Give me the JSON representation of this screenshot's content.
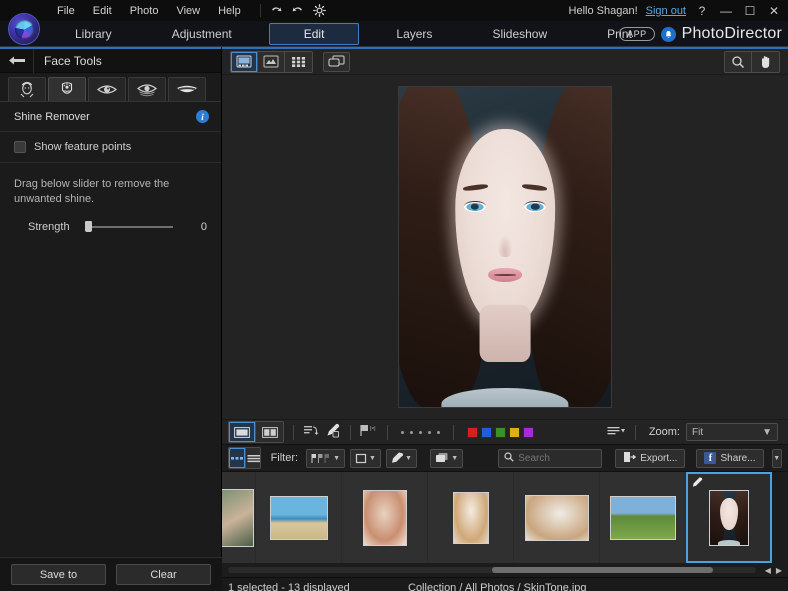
{
  "menubar": {
    "items": [
      {
        "label": "File",
        "name": "menu-file"
      },
      {
        "label": "Edit",
        "name": "menu-edit"
      },
      {
        "label": "Photo",
        "name": "menu-photo"
      },
      {
        "label": "View",
        "name": "menu-view"
      },
      {
        "label": "Help",
        "name": "menu-help"
      }
    ],
    "icons": [
      "undo-icon",
      "redo-icon",
      "settings-gear-icon"
    ],
    "greeting": "Hello Shagan!",
    "signout": "Sign out",
    "help_btn": "?",
    "minimize_btn": "—",
    "maximize_btn": "☐",
    "close_btn": "✕"
  },
  "navbar": {
    "tabs": [
      {
        "label": "Library",
        "active": false
      },
      {
        "label": "Adjustment",
        "active": false
      },
      {
        "label": "Edit",
        "active": true
      },
      {
        "label": "Layers",
        "active": false
      },
      {
        "label": "Slideshow",
        "active": false
      },
      {
        "label": "Print",
        "active": false
      }
    ],
    "app_pill": "APP",
    "brand": "PhotoDirector",
    "accent": "#3f7fc0"
  },
  "left_panel": {
    "back_icon": "back-arrow-icon",
    "title": "Face Tools",
    "tool_tabs": [
      {
        "name": "face-shaper-icon",
        "active": false
      },
      {
        "name": "skin-shine-icon",
        "active": true
      },
      {
        "name": "eye-enhancer-icon",
        "active": false
      },
      {
        "name": "eye-bag-removal-icon",
        "active": false
      },
      {
        "name": "teeth-whitener-icon",
        "active": false
      }
    ],
    "section_title": "Shine Remover",
    "info_icon": "i",
    "checkbox_label": "Show feature points",
    "checkbox_checked": false,
    "hint": "Drag below slider to remove the unwanted shine.",
    "slider": {
      "label": "Strength",
      "value": "0",
      "percent": 0
    },
    "buttons": [
      {
        "label": "Save to",
        "name": "save-to-button"
      },
      {
        "label": "Clear",
        "name": "clear-button"
      }
    ]
  },
  "view_toolbar": {
    "modes": [
      {
        "name": "single-view-icon",
        "active": true
      },
      {
        "name": "compare-view-icon",
        "active": false
      },
      {
        "name": "grid-view-icon",
        "active": false
      }
    ],
    "overlay_icon": "panel-toggle-icon",
    "right_tools": [
      {
        "name": "zoom-tool-icon",
        "active": false
      },
      {
        "name": "hand-tool-icon",
        "active": false
      }
    ]
  },
  "edit_toolbar": {
    "view_buttons": [
      {
        "name": "before-view-icon",
        "active": true
      },
      {
        "name": "before-after-view-icon",
        "active": false
      }
    ],
    "tools": [
      {
        "name": "undo-history-icon"
      },
      {
        "name": "eyedropper-icon"
      },
      {
        "name": "flag-rating-icon"
      }
    ],
    "rating_dots": 5,
    "color_swatches": [
      "#d81f1f",
      "#1f5fd8",
      "#3f8f28",
      "#e0b010",
      "#a02fd8"
    ],
    "list_icon": "list-options-icon",
    "zoom_label": "Zoom:",
    "zoom_value": "Fit"
  },
  "filter_toolbar": {
    "layout_buttons": [
      {
        "name": "thumbnail-view-icon",
        "active": true
      },
      {
        "name": "list-view-icon",
        "active": false
      }
    ],
    "filter_label": "Filter:",
    "filter_dropdowns": [
      {
        "name": "flag-filter-dropdown"
      },
      {
        "name": "rating-filter-dropdown"
      },
      {
        "name": "color-filter-dropdown"
      },
      {
        "name": "stack-filter-dropdown"
      }
    ],
    "search_placeholder": "Search",
    "search_value": "",
    "search_icon": "search-icon",
    "clear_search_icon": "close-icon",
    "export_label": "Export...",
    "share_label": "Share...",
    "facebook_icon": "f",
    "share_dropdown_icon": "chevron-down-icon"
  },
  "filmstrip": {
    "items": [
      {
        "name": "thumb-waterfall-portrait",
        "selected": false,
        "partial": true,
        "colors": [
          "#6f8a6a",
          "#c9b39a",
          "#4a5e46"
        ]
      },
      {
        "name": "thumb-beach-couple",
        "selected": false,
        "partial": false,
        "colors": [
          "#6ab4dd",
          "#d9c79a",
          "#3d8bbf"
        ]
      },
      {
        "name": "thumb-smiling-woman-1",
        "selected": false,
        "partial": false,
        "colors": [
          "#e8d2c0",
          "#c98f72",
          "#f2e4d8"
        ]
      },
      {
        "name": "thumb-laughing-woman",
        "selected": false,
        "partial": false,
        "colors": [
          "#e6d6c4",
          "#d0a878",
          "#f4ece0"
        ]
      },
      {
        "name": "thumb-woman-white-shirt",
        "selected": false,
        "partial": false,
        "colors": [
          "#e6e0d6",
          "#c9a57e",
          "#f0ece6"
        ]
      },
      {
        "name": "thumb-mountain-landscape",
        "selected": false,
        "partial": false,
        "colors": [
          "#7fb0d8",
          "#7fa84a",
          "#5e8a3c"
        ]
      },
      {
        "name": "thumb-skintone-portrait",
        "selected": true,
        "partial": false,
        "colors": [
          "#2b3a44",
          "#e8d8d2",
          "#2e1d16"
        ]
      }
    ],
    "edit_badge_icon": "edit-pencil-icon",
    "prev_arrow": "◀",
    "next_arrow": "▶"
  },
  "statusbar": {
    "selection": "1 selected - 13 displayed",
    "path": "Collection / All Photos / SkinTone.jpg"
  }
}
